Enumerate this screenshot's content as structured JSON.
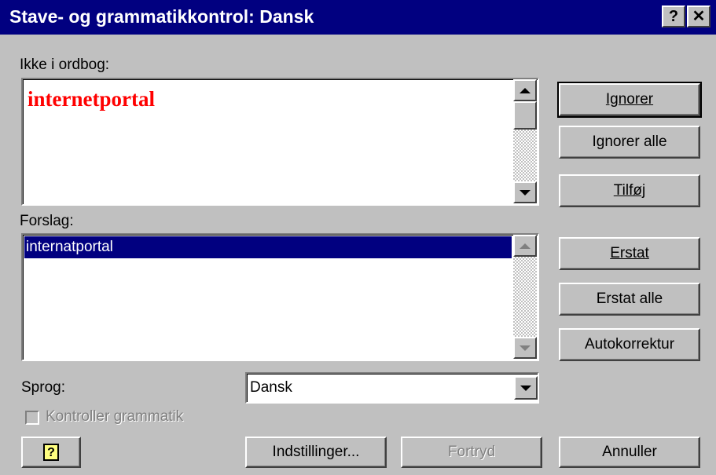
{
  "window": {
    "title": "Stave- og grammatikkontrol: Dansk",
    "help_button": "?",
    "close_button": "✕"
  },
  "not_in_dictionary": {
    "label": "Ikke i ordbog:",
    "word": "internetportal"
  },
  "suggestions": {
    "label": "Forslag:",
    "items": [
      "internatportal"
    ]
  },
  "buttons": {
    "ignore": "Ignorer",
    "ignore_all": "Ignorer alle",
    "add": "Tilføj",
    "replace": "Erstat",
    "replace_all": "Erstat alle",
    "autocorrect": "Autokorrektur",
    "options": "Indstillinger...",
    "undo": "Fortryd",
    "cancel": "Annuller",
    "help_icon": "?"
  },
  "language": {
    "label": "Sprog:",
    "value": "Dansk"
  },
  "check_grammar": {
    "label": "Kontroller grammatik",
    "checked": false,
    "enabled": false
  },
  "colors": {
    "titlebar": "#010080",
    "dialog_bg": "#c0c0c0",
    "selection": "#010080",
    "misspelled_word": "#ff0000"
  },
  "icons": [
    "help-icon",
    "close-icon",
    "scroll-up-icon",
    "scroll-down-icon",
    "dropdown-arrow-icon",
    "assistant-help-icon"
  ]
}
